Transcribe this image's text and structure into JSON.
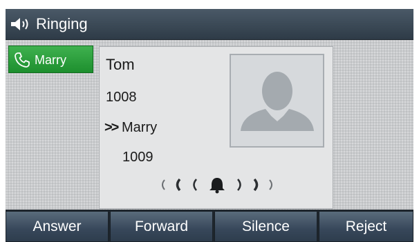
{
  "header": {
    "title": "Ringing",
    "icon": "speaker-volume-icon"
  },
  "line_key": {
    "label": "Marry",
    "icon": "phone-handset-icon",
    "color": "#2a9d3b"
  },
  "call": {
    "caller_name": "Tom",
    "caller_number": "1008",
    "forward_indicator": ">>",
    "forwarded_to_name": "Marry",
    "forwarded_to_number": "1009",
    "avatar_icon": "person-silhouette-icon",
    "ringing_icon": "bell-ringing-icon"
  },
  "softkeys": {
    "answer": "Answer",
    "forward": "Forward",
    "silence": "Silence",
    "reject": "Reject"
  }
}
